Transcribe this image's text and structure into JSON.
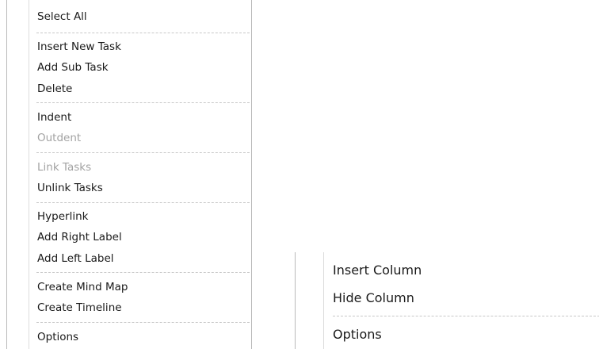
{
  "left_menu": {
    "items": [
      {
        "label": "Select All",
        "enabled": true
      },
      {
        "label": "Insert New Task",
        "enabled": true
      },
      {
        "label": "Add Sub Task",
        "enabled": true
      },
      {
        "label": "Delete",
        "enabled": true
      },
      {
        "label": "Indent",
        "enabled": true
      },
      {
        "label": "Outdent",
        "enabled": false
      },
      {
        "label": "Link Tasks",
        "enabled": false
      },
      {
        "label": "Unlink Tasks",
        "enabled": true
      },
      {
        "label": "Hyperlink",
        "enabled": true
      },
      {
        "label": "Add Right Label",
        "enabled": true
      },
      {
        "label": "Add Left Label",
        "enabled": true
      },
      {
        "label": "Create Mind Map",
        "enabled": true
      },
      {
        "label": "Create Timeline",
        "enabled": true
      },
      {
        "label": "Options",
        "enabled": true
      }
    ]
  },
  "right_menu": {
    "items": [
      {
        "label": "Insert Column",
        "enabled": true
      },
      {
        "label": "Hide Column",
        "enabled": true
      },
      {
        "label": "Options",
        "enabled": true
      }
    ]
  },
  "colors": {
    "text": "#1a1a1a",
    "disabled_text": "#a3a3a3",
    "border": "#b9b9b9",
    "separator": "#c8c8c8"
  }
}
